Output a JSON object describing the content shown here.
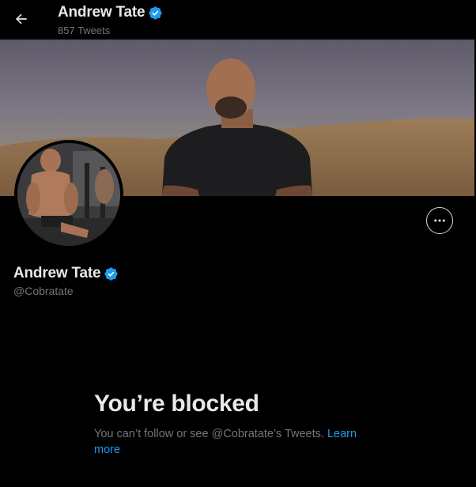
{
  "header": {
    "name": "Andrew Tate",
    "tweet_count": "857 Tweets"
  },
  "profile": {
    "name": "Andrew Tate",
    "handle": "@Cobratate"
  },
  "blocked": {
    "title": "You’re blocked",
    "message": "You can’t follow or see @Cobratate’s Tweets.",
    "link": "Learn more"
  },
  "icons": {
    "back": "back-arrow-icon",
    "verified": "verified-badge-icon",
    "more": "more-horizontal-icon"
  },
  "colors": {
    "accent": "#1d9bf0",
    "background": "#000000",
    "text": "#e7e9ea",
    "secondary_text": "#71767b"
  }
}
